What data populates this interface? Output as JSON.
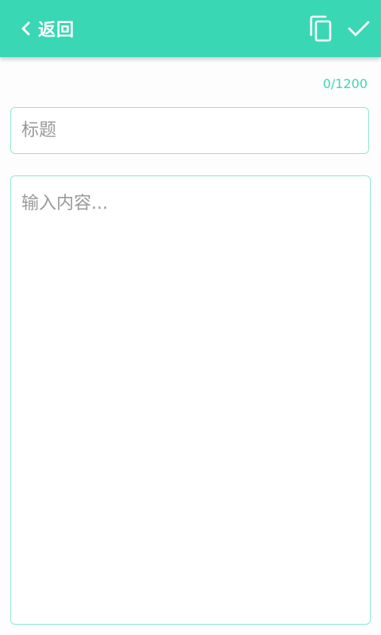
{
  "header": {
    "back_label": "返回",
    "back_icon": "chevron-left-icon",
    "copy_icon": "copy-icon",
    "confirm_icon": "checkmark-icon",
    "bg_color": "#3ad7b5"
  },
  "editor": {
    "char_counter": "0/1200",
    "title_placeholder": "标题",
    "title_value": "",
    "content_placeholder": "输入内容...",
    "content_value": "",
    "accent_color": "#3ad7b5"
  }
}
